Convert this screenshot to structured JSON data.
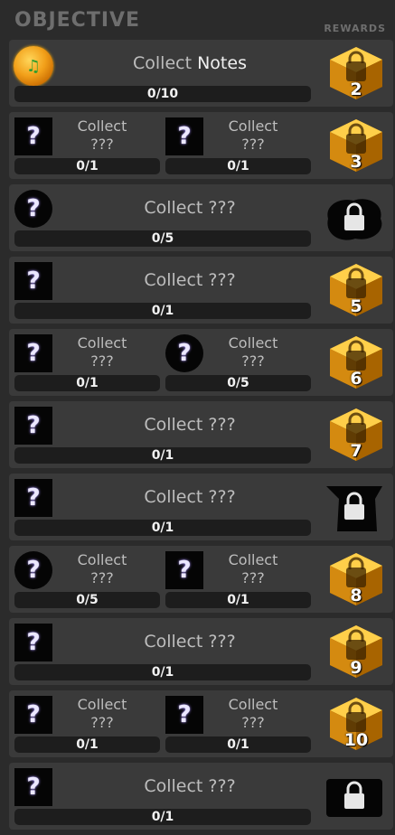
{
  "header": {
    "title": "OBJECTIVE",
    "rewards_label": "REWARDS"
  },
  "collect_word": "Collect",
  "unknown": "???",
  "rows": [
    {
      "type": "single",
      "icon": "notes-orb-icon",
      "name": "Notes",
      "progress": "0/10",
      "reward": "2"
    },
    {
      "type": "double",
      "left": {
        "icon": "square",
        "progress": "0/1"
      },
      "right": {
        "icon": "square",
        "progress": "0/1"
      },
      "reward": "3"
    },
    {
      "type": "single",
      "icon": "circle",
      "name": "???",
      "progress": "0/5",
      "reward": "locked-blob"
    },
    {
      "type": "single",
      "icon": "square",
      "name": "???",
      "progress": "0/1",
      "reward": "5"
    },
    {
      "type": "double",
      "left": {
        "icon": "square",
        "progress": "0/1"
      },
      "right": {
        "icon": "circle",
        "progress": "0/5"
      },
      "reward": "6"
    },
    {
      "type": "single",
      "icon": "square",
      "name": "???",
      "progress": "0/1",
      "reward": "7"
    },
    {
      "type": "single",
      "icon": "square",
      "name": "???",
      "progress": "0/1",
      "reward": "locked-shield"
    },
    {
      "type": "double",
      "left": {
        "icon": "circle",
        "progress": "0/5"
      },
      "right": {
        "icon": "square",
        "progress": "0/1"
      },
      "reward": "8"
    },
    {
      "type": "single",
      "icon": "square",
      "name": "???",
      "progress": "0/1",
      "reward": "9"
    },
    {
      "type": "double",
      "left": {
        "icon": "square",
        "progress": "0/1"
      },
      "right": {
        "icon": "square",
        "progress": "0/1"
      },
      "reward": "10"
    },
    {
      "type": "single",
      "icon": "square",
      "name": "???",
      "progress": "0/1",
      "reward": "locked-box"
    }
  ],
  "colors": {
    "background": "#2b2b2b",
    "row": "#3a3a3a",
    "bar": "#1d1d1d",
    "gold": "#e2a21c",
    "question_glow": "#a58cff"
  }
}
